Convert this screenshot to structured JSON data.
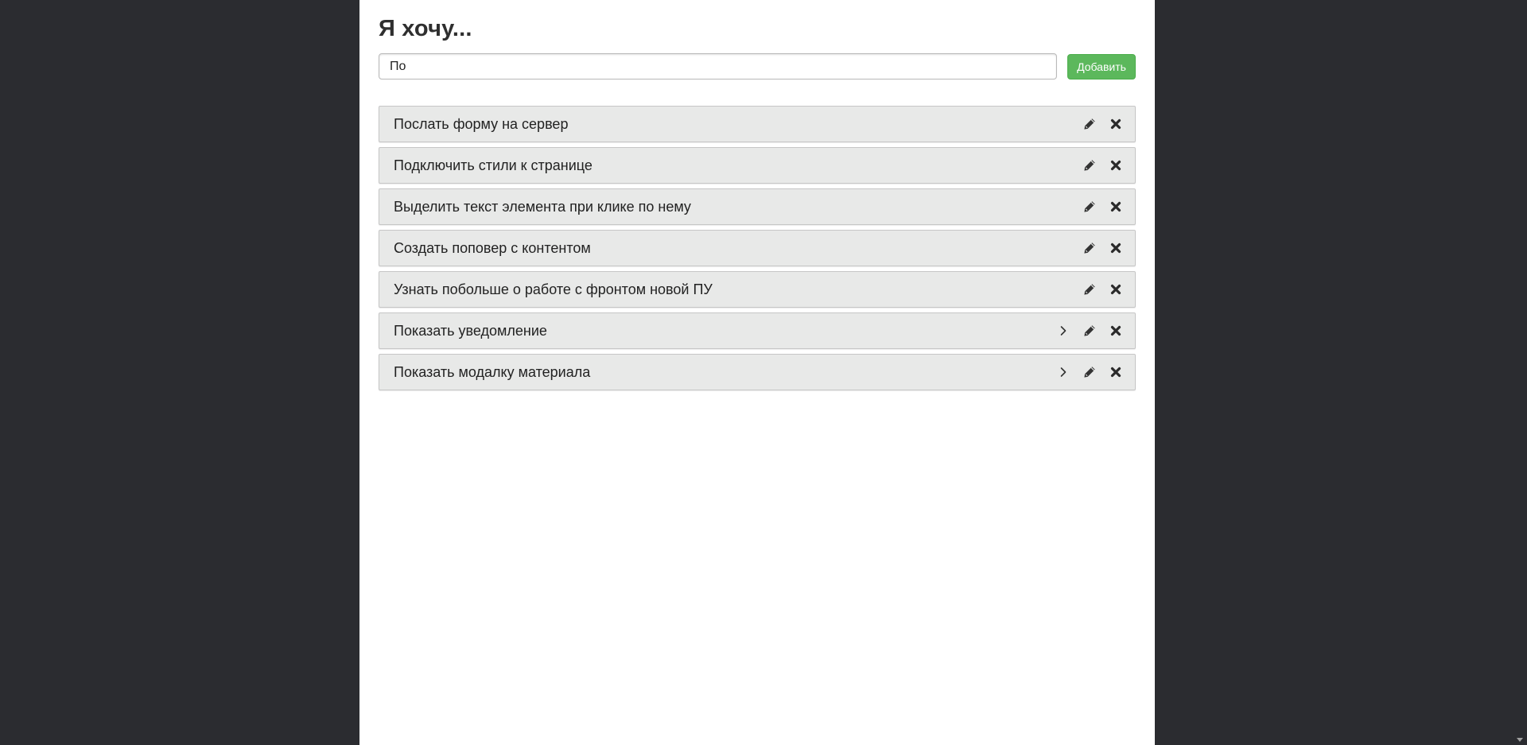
{
  "header": {
    "title": "Я хочу..."
  },
  "form": {
    "input_value": "По",
    "add_label": "Добавить"
  },
  "tasks": [
    {
      "text": "Послать форму на сервер",
      "has_expand": false
    },
    {
      "text": "Подключить стили к странице",
      "has_expand": false
    },
    {
      "text": "Выделить текст элемента при клике по нему",
      "has_expand": false
    },
    {
      "text": "Создать поповер с контентом",
      "has_expand": false
    },
    {
      "text": "Узнать побольше о работе с фронтом новой ПУ",
      "has_expand": false
    },
    {
      "text": "Показать уведомление",
      "has_expand": true
    },
    {
      "text": "Показать модалку материала",
      "has_expand": true
    }
  ],
  "icons": {
    "expand": "chevron-right-icon",
    "edit": "pencil-icon",
    "delete": "close-icon"
  },
  "colors": {
    "background": "#2b2c30",
    "panel": "#ffffff",
    "item_background": "#e8e9e8",
    "add_button": "#5cb85c"
  }
}
